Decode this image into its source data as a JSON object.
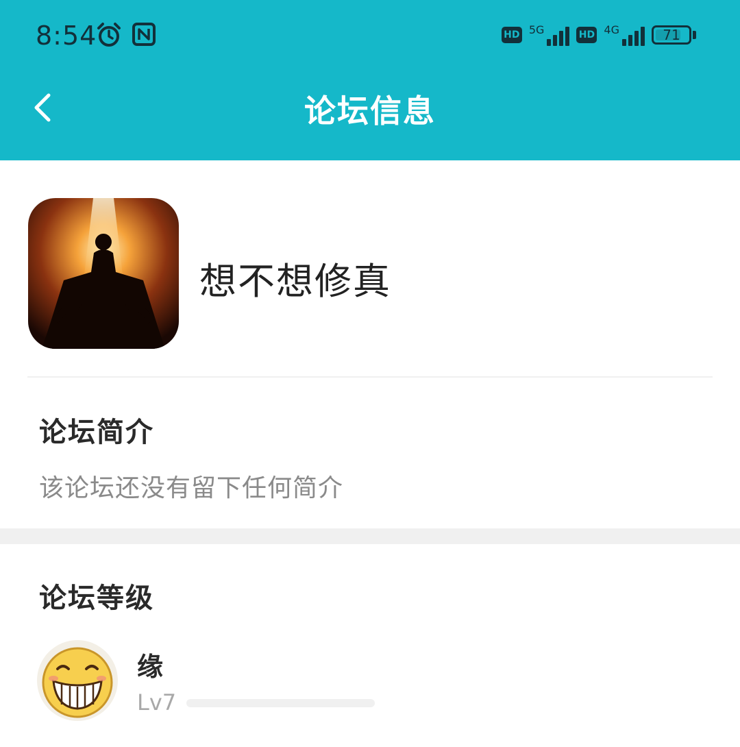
{
  "status_bar": {
    "time": "8:54",
    "network1": "5G",
    "network2": "4G",
    "hd_label": "HD",
    "battery": "71",
    "icons": [
      "alarm-icon",
      "nfc-icon"
    ]
  },
  "header": {
    "title": "论坛信息",
    "back_icon": "chevron-left-icon",
    "accent_color": "#15b8c9"
  },
  "forum": {
    "name": "想不想修真"
  },
  "intro_section": {
    "title": "论坛简介",
    "text": "该论坛还没有留下任何简介"
  },
  "level_section": {
    "title": "论坛等级",
    "member": {
      "name": "缘",
      "level": "Lv7",
      "progress": 0
    }
  }
}
